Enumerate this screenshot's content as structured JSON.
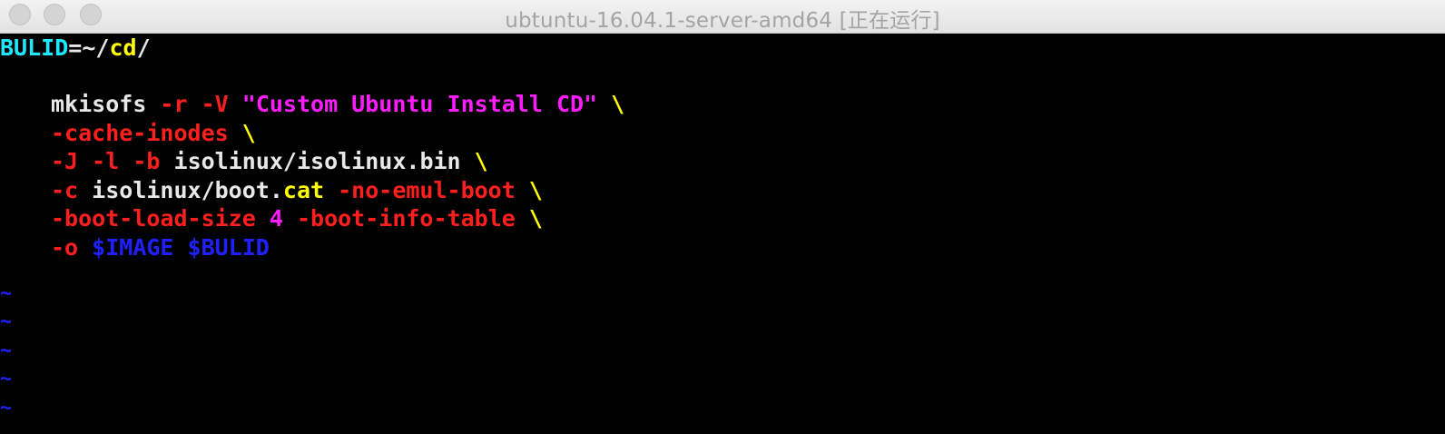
{
  "window": {
    "title": "ubtuntu-16.04.1-server-amd64 [正在运行]"
  },
  "terminal": {
    "line1": {
      "var": "BULID",
      "eq": "=",
      "tilde": "~",
      "slash": "/",
      "dir": "cd",
      "slash2": "/"
    },
    "line2": {
      "cmd": "mkisofs",
      "opt_r": "-r",
      "opt_v": "-V",
      "label": "\"Custom Ubuntu Install CD\"",
      "cont": "\\"
    },
    "line3": {
      "opt": "-cache-inodes",
      "cont": "\\"
    },
    "line4": {
      "opt_j": "-J",
      "opt_l": "-l",
      "opt_b": "-b",
      "path": "isolinux/isolinux.bin",
      "cont": "\\"
    },
    "line5": {
      "opt_c": "-c",
      "path": "isolinux/boot.",
      "ext": "cat",
      "opt": "-no-emul-boot",
      "cont": "\\"
    },
    "line6": {
      "opt1": "-boot-load-size",
      "num": "4",
      "opt2": "-boot-info-table",
      "cont": "\\"
    },
    "line7": {
      "opt_o": "-o",
      "image": "$IMAGE",
      "build": "$BULID"
    },
    "empty_line_marker": "~"
  },
  "colors": {
    "default_text": "#e8e8e8",
    "option": "#ff1f1f",
    "string": "#ff1cff",
    "special": "#ffff00",
    "variable_ref": "#2020ff",
    "identifier": "#1ee8ff",
    "background": "#000000"
  }
}
